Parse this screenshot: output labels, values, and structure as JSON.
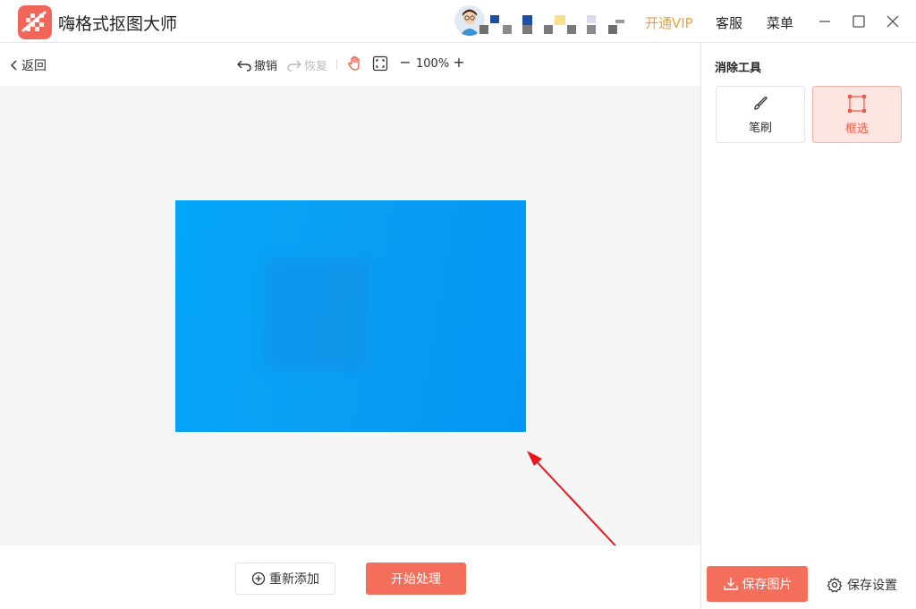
{
  "app": {
    "title": "嗨格式抠图大师",
    "brand_color": "#f2665a"
  },
  "header": {
    "vip_label": "开通VIP",
    "vip_color": "#e6a23c",
    "service_label": "客服",
    "menu_label": "菜单"
  },
  "toolbar": {
    "back_label": "返回",
    "undo_label": "撤销",
    "redo_label": "恢复",
    "zoom_level": "100%",
    "zoom_out_label": "−",
    "zoom_in_label": "+"
  },
  "canvas": {
    "image_color": "#03a1f5",
    "arrow_color": "#e8161c"
  },
  "bottom": {
    "readd_label": "重新添加",
    "start_label": "开始处理",
    "accent_color": "#f46e5c"
  },
  "right_panel": {
    "title": "消除工具",
    "tools": [
      {
        "label": "笔刷",
        "icon": "brush-icon",
        "selected": false
      },
      {
        "label": "框选",
        "icon": "box-select-icon",
        "selected": true
      }
    ],
    "save_image_label": "保存图片",
    "save_settings_label": "保存设置"
  }
}
